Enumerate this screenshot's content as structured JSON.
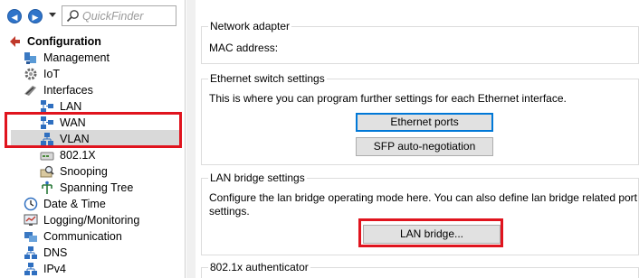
{
  "toolbar": {
    "quickfinder_placeholder": "QuickFinder"
  },
  "tree": {
    "root": "Configuration",
    "items": [
      {
        "label": "Management",
        "icon": "management-icon"
      },
      {
        "label": "IoT",
        "icon": "iot-gear-icon"
      },
      {
        "label": "Interfaces",
        "icon": "interfaces-icon"
      },
      {
        "label": "LAN",
        "icon": "lan-network-icon"
      },
      {
        "label": "WAN",
        "icon": "wan-network-icon"
      },
      {
        "label": "VLAN",
        "icon": "vlan-network-icon"
      },
      {
        "label": "802.1X",
        "icon": "8021x-device-icon"
      },
      {
        "label": "Snooping",
        "icon": "snooping-magnifier-icon"
      },
      {
        "label": "Spanning Tree",
        "icon": "spanning-tree-icon"
      },
      {
        "label": "Date & Time",
        "icon": "clock-icon"
      },
      {
        "label": "Logging/Monitoring",
        "icon": "monitoring-icon"
      },
      {
        "label": "Communication",
        "icon": "communication-icon"
      },
      {
        "label": "DNS",
        "icon": "dns-network-icon"
      },
      {
        "label": "IPv4",
        "icon": "ipv4-network-icon"
      }
    ],
    "selected": "LAN"
  },
  "main": {
    "network_adapter": {
      "title": "Network adapter",
      "mac_label": "MAC address:"
    },
    "ethernet_switch": {
      "title": "Ethernet switch settings",
      "description": "This is where you can program further settings for each Ethernet interface.",
      "ethernet_ports_button": "Ethernet ports",
      "sfp_button": "SFP auto-negotiation"
    },
    "lan_bridge": {
      "title": "LAN bridge settings",
      "description_line1": "Configure the lan bridge operating mode here. You can also define lan bridge related port",
      "description_line2": "settings.",
      "button": "LAN bridge..."
    },
    "authenticator": {
      "title": "802.1x authenticator"
    }
  },
  "colors": {
    "highlight": "#e0141e",
    "selection": "#d9d9d9",
    "focus": "#0078d7",
    "accent_blue": "#2f74c9"
  }
}
